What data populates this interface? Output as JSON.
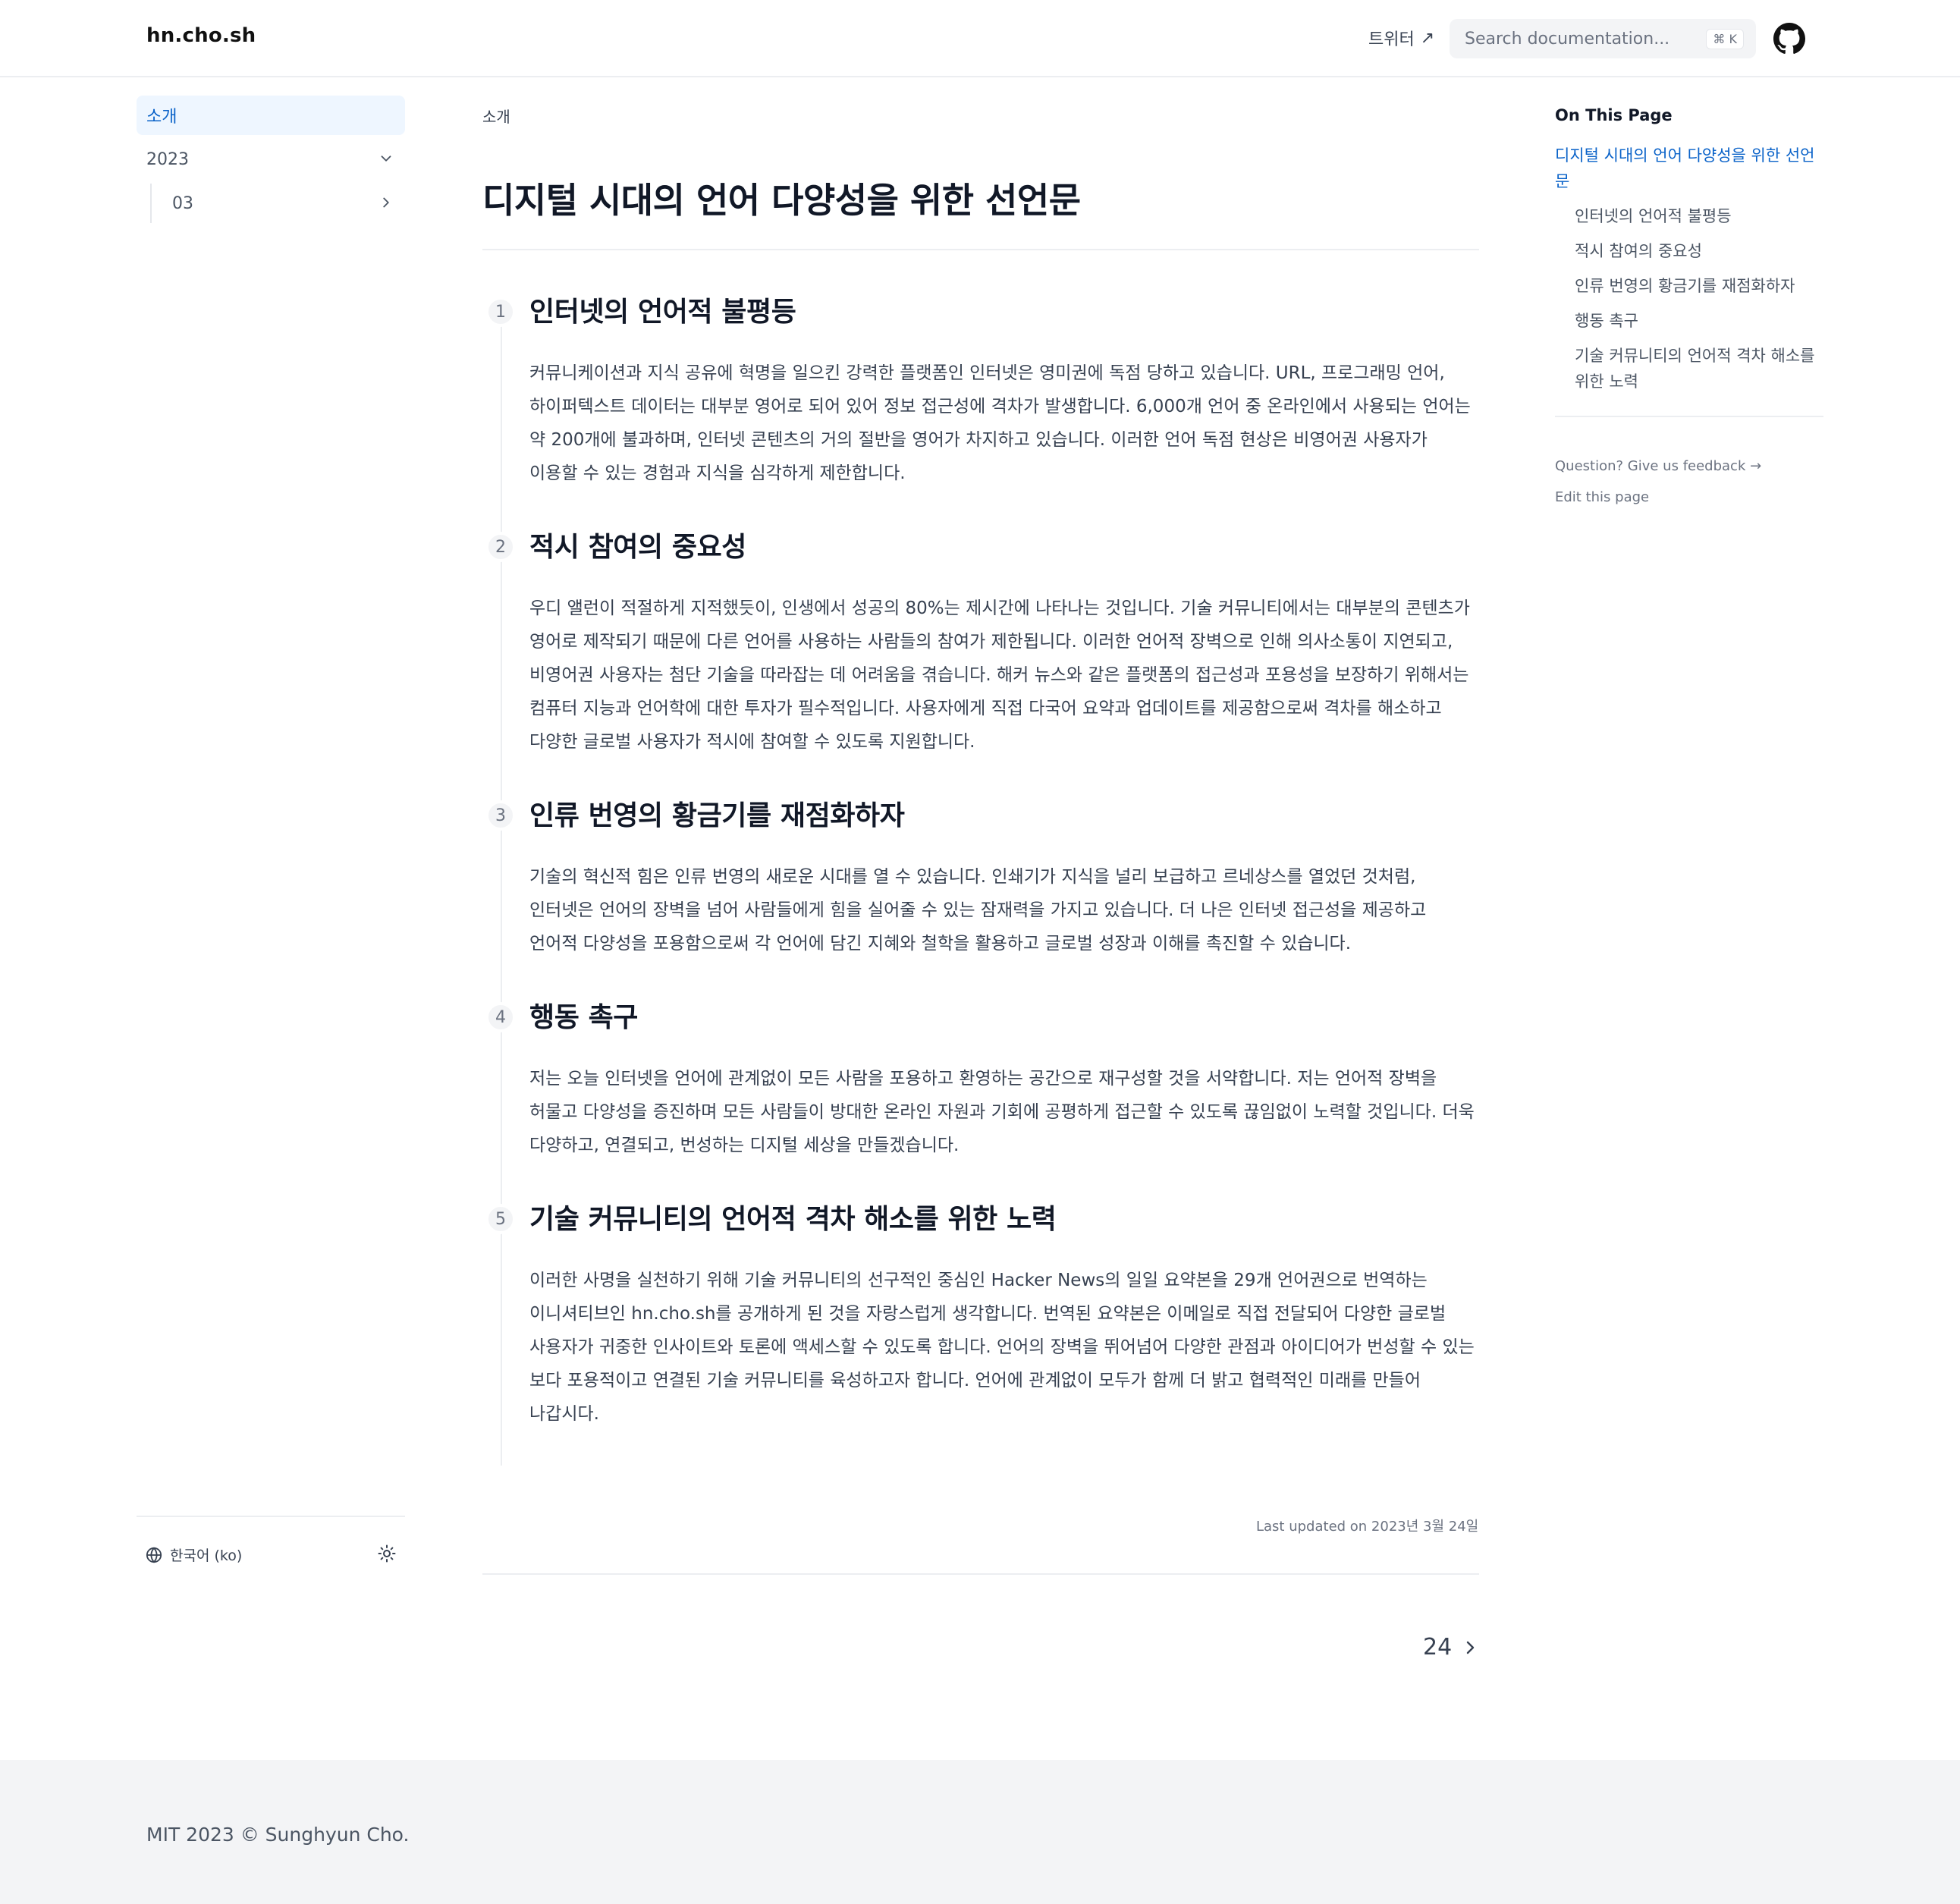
{
  "header": {
    "logo": "hn.cho.sh",
    "twitter_label": "트위터",
    "twitter_arrow": "↗",
    "search_placeholder": "Search documentation...",
    "search_shortcut": "⌘ K"
  },
  "sidebar": {
    "items": [
      {
        "label": "소개",
        "active": true
      },
      {
        "label": "2023",
        "expanded": true
      },
      {
        "label": "03",
        "expanded": false
      }
    ],
    "language": "한국어 (ko)"
  },
  "main": {
    "breadcrumb": "소개",
    "title": "디지털 시대의 언어 다양성을 위한 선언문",
    "sections": [
      {
        "number": "1",
        "title": "인터넷의 언어적 불평등",
        "body": "커뮤니케이션과 지식 공유에 혁명을 일으킨 강력한 플랫폼인 인터넷은 영미권에 독점 당하고 있습니다. URL, 프로그래밍 언어, 하이퍼텍스트 데이터는 대부분 영어로 되어 있어 정보 접근성에 격차가 발생합니다. 6,000개 언어 중 온라인에서 사용되는 언어는 약 200개에 불과하며, 인터넷 콘텐츠의 거의 절반을 영어가 차지하고 있습니다. 이러한 언어 독점 현상은 비영어권 사용자가 이용할 수 있는 경험과 지식을 심각하게 제한합니다."
      },
      {
        "number": "2",
        "title": "적시 참여의 중요성",
        "body": "우디 앨런이 적절하게 지적했듯이, 인생에서 성공의 80%는 제시간에 나타나는 것입니다. 기술 커뮤니티에서는 대부분의 콘텐츠가 영어로 제작되기 때문에 다른 언어를 사용하는 사람들의 참여가 제한됩니다. 이러한 언어적 장벽으로 인해 의사소통이 지연되고, 비영어권 사용자는 첨단 기술을 따라잡는 데 어려움을 겪습니다. 해커 뉴스와 같은 플랫폼의 접근성과 포용성을 보장하기 위해서는 컴퓨터 지능과 언어학에 대한 투자가 필수적입니다. 사용자에게 직접 다국어 요약과 업데이트를 제공함으로써 격차를 해소하고 다양한 글로벌 사용자가 적시에 참여할 수 있도록 지원합니다."
      },
      {
        "number": "3",
        "title": "인류 번영의 황금기를 재점화하자",
        "body": "기술의 혁신적 힘은 인류 번영의 새로운 시대를 열 수 있습니다. 인쇄기가 지식을 널리 보급하고 르네상스를 열었던 것처럼, 인터넷은 언어의 장벽을 넘어 사람들에게 힘을 실어줄 수 있는 잠재력을 가지고 있습니다. 더 나은 인터넷 접근성을 제공하고 언어적 다양성을 포용함으로써 각 언어에 담긴 지혜와 철학을 활용하고 글로벌 성장과 이해를 촉진할 수 있습니다."
      },
      {
        "number": "4",
        "title": "행동 촉구",
        "body": "저는 오늘 인터넷을 언어에 관계없이 모든 사람을 포용하고 환영하는 공간으로 재구성할 것을 서약합니다. 저는 언어적 장벽을 허물고 다양성을 증진하며 모든 사람들이 방대한 온라인 자원과 기회에 공평하게 접근할 수 있도록 끊임없이 노력할 것입니다. 더욱 다양하고, 연결되고, 번성하는 디지털 세상을 만들겠습니다."
      },
      {
        "number": "5",
        "title": "기술 커뮤니티의 언어적 격차 해소를 위한 노력",
        "body": "이러한 사명을 실천하기 위해 기술 커뮤니티의 선구적인 중심인 Hacker News의 일일 요약본을 29개 언어권으로 번역하는 이니셔티브인 hn.cho.sh를 공개하게 된 것을 자랑스럽게 생각합니다. 번역된 요약본은 이메일로 직접 전달되어 다양한 글로벌 사용자가 귀중한 인사이트와 토론에 액세스할 수 있도록 합니다. 언어의 장벽을 뛰어넘어 다양한 관점과 아이디어가 번성할 수 있는 보다 포용적이고 연결된 기술 커뮤니티를 육성하고자 합니다. 언어에 관계없이 모두가 함께 더 밝고 협력적인 미래를 만들어 나갑시다."
      }
    ],
    "last_updated": "Last updated on 2023년 3월 24일",
    "next_label": "24"
  },
  "toc": {
    "heading": "On This Page",
    "items": [
      {
        "label": "디지털 시대의 언어 다양성을 위한 선언문",
        "level": 1
      },
      {
        "label": "인터넷의 언어적 불평등",
        "level": 2
      },
      {
        "label": "적시 참여의 중요성",
        "level": 2
      },
      {
        "label": "인류 번영의 황금기를 재점화하자",
        "level": 2
      },
      {
        "label": "행동 촉구",
        "level": 2
      },
      {
        "label": "기술 커뮤니티의 언어적 격차 해소를 위한 노력",
        "level": 2
      }
    ],
    "feedback_link": "Question? Give us feedback →",
    "edit_link": "Edit this page"
  },
  "footer": {
    "text": "MIT 2023 © Sunghyun Cho."
  },
  "colors": {
    "accent": "#0b63c9",
    "active_bg": "#eef6ff",
    "footer_bg": "#f3f4f6"
  }
}
